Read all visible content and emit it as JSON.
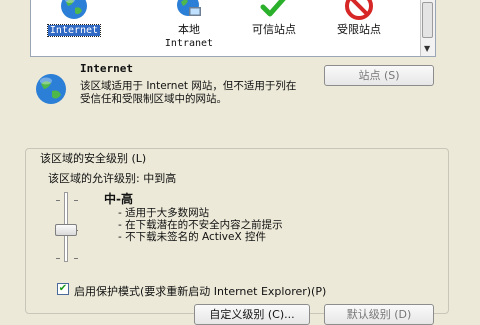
{
  "zones": [
    {
      "label": "Internet",
      "selected": true,
      "icon": "globe-icon"
    },
    {
      "label": "本地",
      "sublabel": "Intranet",
      "icon": "local-intranet-icon"
    },
    {
      "label": "可信站点",
      "icon": "green-check-icon"
    },
    {
      "label": "受限站点",
      "icon": "no-entry-icon"
    }
  ],
  "sites_button": "站点 (S)",
  "zone_info": {
    "title": "Internet",
    "description": "该区域适用于 Internet 网站，但不适用于列在受信任和受限制区域中的网站。",
    "icon": "globe-icon"
  },
  "security_level": {
    "group_title": "该区域的安全级别 (L)",
    "allowed_label": "该区域的允许级别: 中到高",
    "level_name": "中-高",
    "bullets": [
      "适用于大多数网站",
      "在下载潜在的不安全内容之前提示",
      "不下载未签名的 ActiveX 控件"
    ]
  },
  "protected_mode": {
    "checked": true,
    "label": "启用保护模式(要求重新启动 Internet Explorer)(P)"
  },
  "buttons": {
    "custom_level": "自定义级别 (C)...",
    "default_level": "默认级别 (D)"
  },
  "colors": {
    "dialog_bg": "#ece9d8",
    "selection": "#316ac5",
    "check_green": "#2bb02b",
    "stop_red": "#d62626"
  }
}
